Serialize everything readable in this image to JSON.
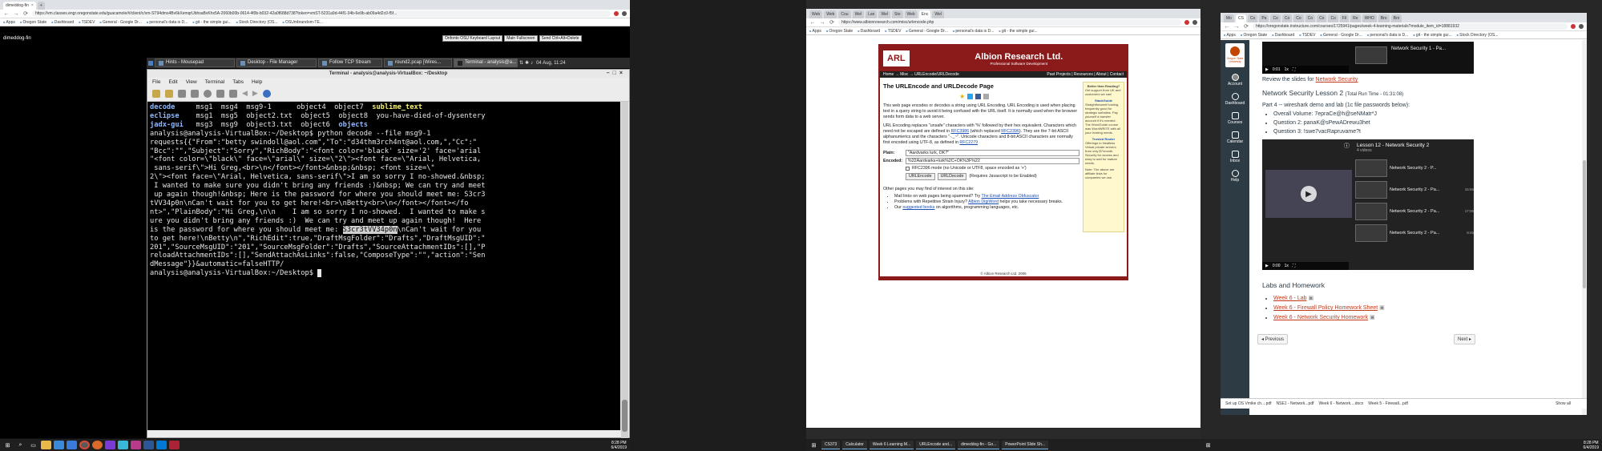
{
  "left_browser": {
    "tabs": [
      "dimeddog-fin"
    ],
    "url": "https://vm.classes.engr.oregonstate.edu/guacamole/#/client/c/vm-ST94dms4Bv6kXemqrUbhsaBvKhx5A-2060b00b-0614-4f0b-b032-42a0f688d738?token=vmST-5231a9d-44f1-34b-6e9b-ab09a4d2c0-f5f...",
    "bookmarks": [
      "Apps",
      "Oregon State",
      "Dashboard",
      "TSDEV",
      "General - Google Dr...",
      "personal's data is D...",
      "git - the simple gui...",
      "Stock Directory (OS...",
      "OSUmbrandom-TE..."
    ],
    "vm": {
      "host_label": "dimeddog-fin",
      "buttons": [
        "Onfonto OSU Keyboard Layout",
        "Main Fullscreen",
        "Send Ctrl+Alt+Delete"
      ],
      "panel_tasks": [
        "Hints - Mousepad",
        "Desktop - File Manager",
        "Follow TCP Stream",
        "round2.pcap [Wires...",
        "Terminal - analysis@a..."
      ],
      "panel_clock": "04 Aug, 11:24",
      "terminal": {
        "title": "Terminal - analysis@analysis-VirtualBox: ~/Desktop",
        "menu": [
          "File",
          "Edit",
          "View",
          "Terminal",
          "Tabs",
          "Help"
        ],
        "lines": [
          {
            "parts": [
              [
                "b",
                "decode"
              ],
              [
                "n",
                "     msg1  msg4  msg9-1      object4  object7  "
              ],
              [
                "y",
                "sublime_text"
              ]
            ]
          },
          {
            "parts": [
              [
                "b",
                "eclipse"
              ],
              [
                "n",
                "    msg1  msg5  object2.txt  object5  object8  you-have-died-of-dysentery"
              ]
            ]
          },
          {
            "parts": [
              [
                "b",
                "jadx-gui"
              ],
              [
                "n",
                "   msg3  msg9  object3.txt  object6  "
              ],
              [
                "b",
                "objects"
              ]
            ]
          },
          {
            "parts": [
              [
                "n",
                "analysis@analysis-VirtualBox:~/Desktop$ python decode --file msg9-1"
              ]
            ]
          },
          {
            "parts": [
              [
                "n",
                "requests{{\"From\":\"betty swindoll@aol.com\",\"To\":\"d34thm3rch4nt@aol.com,\",\"Cc\":\""
              ]
            ]
          },
          {
            "parts": [
              [
                "n",
                "\"Bcc\":\"\",\"Subject\":\"Sorry\",\"RichBody\":\"<font color='black' size='2' face='arial"
              ]
            ]
          },
          {
            "parts": [
              [
                "n",
                "\"<font color=\\\"black\\\" face=\\\"arial\\\" size=\\\"2\\\"><font face=\\\"Arial, Helvetica,"
              ]
            ]
          },
          {
            "parts": [
              [
                "n",
                " sans-serif\\\">Hi Greg,<br>\\n</font></font>&nbsp;&nbsp; <font size=\\\""
              ]
            ]
          },
          {
            "parts": [
              [
                "n",
                "2\\\"><font face=\\\"Arial, Helvetica, sans-serif\\\">I am so sorry I no-showed.&nbsp;"
              ]
            ]
          },
          {
            "parts": [
              [
                "n",
                " I wanted to make sure you didn't bring any friends :)&nbsp; We can try and meet"
              ]
            ]
          },
          {
            "parts": [
              [
                "n",
                " up again though!&nbsp; Here is the password for where you should meet me: S3cr3"
              ]
            ]
          },
          {
            "parts": [
              [
                "n",
                "tVV34p0n\\nCan't wait for you to get here!<br>\\nBetty<br>\\n</font></font></fo"
              ]
            ]
          },
          {
            "parts": [
              [
                "n",
                "nt>\",\"PlainBody\":\"Hi Greg,\\n\\n    I am so sorry I no-showed.  I wanted to make s"
              ]
            ]
          },
          {
            "parts": [
              [
                "n",
                "ure you didn't bring any friends :)  We can try and meet up again though!  Here"
              ]
            ]
          },
          {
            "parts": [
              [
                "n",
                "is the password for where you should meet me: "
              ],
              [
                "s",
                "S3cr3tVV34p0n"
              ],
              [
                "n",
                "\\nCan't wait for you"
              ]
            ]
          },
          {
            "parts": [
              [
                "n",
                "to get here!\\nBetty\\n\",\"RichEdit\":true,\"DraftMsgFolder\":\"Drafts\",\"DraftMsgUID\":\""
              ]
            ]
          },
          {
            "parts": [
              [
                "n",
                "201\",\"SourceMsgUID\":\"201\",\"SourceMsgFolder\":\"Drafts\",\"SourceAttachmentIDs\":[],\"P"
              ]
            ]
          },
          {
            "parts": [
              [
                "n",
                "reloadAttachmentIDs\":[],\"SendAttachAsLinks\":false,\"ComposeType\":\"\",\"action\":\"Sen"
              ]
            ]
          },
          {
            "parts": [
              [
                "n",
                "dMessage\"}}&automatic=falseHTTP/"
              ]
            ]
          },
          {
            "parts": [
              [
                "n",
                "analysis@analysis-VirtualBox:~/Desktop$ "
              ],
              [
                "c",
                " "
              ]
            ]
          }
        ]
      }
    },
    "taskbar_clock": {
      "time": "8:28 PM",
      "date": "6/4/2019"
    }
  },
  "middle_browser": {
    "tabs": [
      "Web",
      "Web",
      "Cou",
      "Wel",
      "Lan",
      "Wel",
      "Sto",
      "Web",
      "Enc",
      "Wel"
    ],
    "url": "https://www.albionresearch.com/misc/urlencode.php",
    "bookmarks": [
      "Apps",
      "Oregon State",
      "Dashboard",
      "TSDEV",
      "General - Google Dr...",
      "personal's data is D...",
      "git - the simple gui...",
      "Stock Directory (OS...",
      "OSUmbrandom-TE..."
    ],
    "page": {
      "logo": "ARL",
      "company": "Albion Research Ltd.",
      "tagline": "Professional Software Development",
      "breadcrumb": "Home → Misc → URLEncode/URLDecode",
      "navlinks": "Past Projects | Resources | About | Contact",
      "heading": "The URLEncode and URLDecode Page",
      "para1": "This web page encodes or decodes a string using URL Encoding. URL Encoding is used when placing text in a query string to avoid it being confused with the URL itself. It is normally used when the browser sends form data to a web server.",
      "para2a": "URL Encoding replaces \"unsafe\" characters with '%' followed by their hex equivalent. Characters which need not be escaped are defined in ",
      "rfc1": "RFC3986",
      "para2b": " (which replaced ",
      "rfc2": "RFC2396",
      "para2c": "). They are the 7-bit ASCII alphanumerics and the characters \"-._~\". Unicode characters and 8-bit ASCII characters are normally first encoded using UTF-8, as defined in ",
      "rfc3": "RFC2279",
      "plain_label": "Plain:",
      "plain_value": "\"Aardvarks lurk, OK?\"",
      "encoded_label": "Encoded:",
      "encoded_value": "%22Aardvarks+lurk%2C+OK%3F%22",
      "checkbox_text": "RFC2396 mode (no Unicode or UTF8, space encoded as '+')",
      "btn_encode": "URLEncode",
      "btn_decode": "URLDecode",
      "js_note": "(Requires Javascript to be Enabled)",
      "other_pages": "Other pages you may find of interest on this site:",
      "bullets": [
        {
          "pre": "Mail links on web pages being spammed? Try ",
          "link": "The Email Address Obfuscator",
          "post": ""
        },
        {
          "pre": "Problems with Repetitive Strain Injury? ",
          "link": "Albion DigiWord",
          "post": " helps you take necessary breaks."
        },
        {
          "pre": "Our ",
          "link": "suggested books",
          "post": " on algorithms, programming languages, etc."
        }
      ],
      "copyright": "© Albion Research Ltd. 2006",
      "sidebar": {
        "title1": "Better than Reading?",
        "text1": "Get support from UK and customers we can!",
        "title2": "StackGuide",
        "text2": "Straightforward hosting, frequently good for strategic websites. Pay yourself a transfer account if it's needed. The WordGuide course was WordWRITE with all your hosting needs.",
        "title3": "Trusted Router",
        "text3": "Offerings to Neatless Virtual private servers from only $7/month. Security for access and easy to add for mature needs.",
        "text4": "Note: The above are affiliate links for companies we use."
      }
    },
    "taskbar_items": [
      "CS373",
      "Calculator",
      "Week 6 Learning M...",
      "URLEncode and...",
      "dimeddog-fin - Go...",
      "PowerPoint Slide Sh..."
    ]
  },
  "right_browser": {
    "tabs": [
      "Mo",
      "CS",
      "Co",
      "Pa",
      "Co",
      "Co",
      "Co",
      "Co",
      "Co",
      "Co",
      "Fil",
      "Re",
      "WHO",
      "Bro",
      "Bro"
    ],
    "url": "https://oregonstate.instructure.com/courses/1725941/pages/week-4-learning-materials?module_item_id=18881932",
    "bookmarks": [
      "Apps",
      "Oregon State",
      "Dashboard",
      "TSDEV",
      "General - Google Dr...",
      "personal's data is D...",
      "git - the simple gui...",
      "Stock Directory (OS..."
    ],
    "nav": [
      {
        "label": "Account",
        "icon": "account-icon"
      },
      {
        "label": "Dashboard",
        "icon": "dashboard-icon"
      },
      {
        "label": "Courses",
        "icon": "courses-icon"
      },
      {
        "label": "Calendar",
        "icon": "calendar-icon"
      },
      {
        "label": "Inbox",
        "icon": "inbox-icon"
      },
      {
        "label": "Help",
        "icon": "help-icon"
      }
    ],
    "logo_text": "Oregon State University",
    "video1": {
      "time": "0:01",
      "speed": "1x",
      "playlist_item": "Network Security 1 - Pa..."
    },
    "review_pre": "Review the slides for ",
    "review_link": "Network Security",
    "lesson_title": "Network Security Lesson 2",
    "lesson_runtime": "(Total Run Time - 01:31:08)",
    "part_text": "Part 4 -- wireshark demo and lab (1c file passwords below):",
    "bullets": [
      "Overall Volume: 7epraCe@h@seNMatr*J",
      "Question 2: panaK@sPewADrewu3het",
      "Question 3: !swe7vacRapruvame?t"
    ],
    "video2": {
      "title": "Lesson 12 - Network Security 2",
      "count": "4 videos",
      "time": "0:00",
      "speed": "1x",
      "items": [
        "Network Security 2 - P...",
        "Network Security 2 - Pa...",
        "Network Security 2 - Pa...",
        "Network Security 2 - Pa..."
      ],
      "durations": [
        "",
        "15:56",
        "17:06",
        "9:45"
      ]
    },
    "labs_heading": "Labs and Homework",
    "labs": [
      "Week 6 - Lab",
      "Week 6 - Firewall Policy Homework Sheet",
      "Week 6 - Network Security Homework"
    ],
    "prev_btn": "◂ Previous",
    "next_btn": "Next ▸",
    "downloads": [
      "Set up OS Vmike ch....pdf",
      "NSE1 - Network...pdf",
      "Week 6 - Network....docx",
      "Week 5 - Firewall...pdf"
    ],
    "show_all": "Show all",
    "taskbar_clock": {
      "time": "8:28 PM",
      "date": "6/4/2019"
    }
  }
}
